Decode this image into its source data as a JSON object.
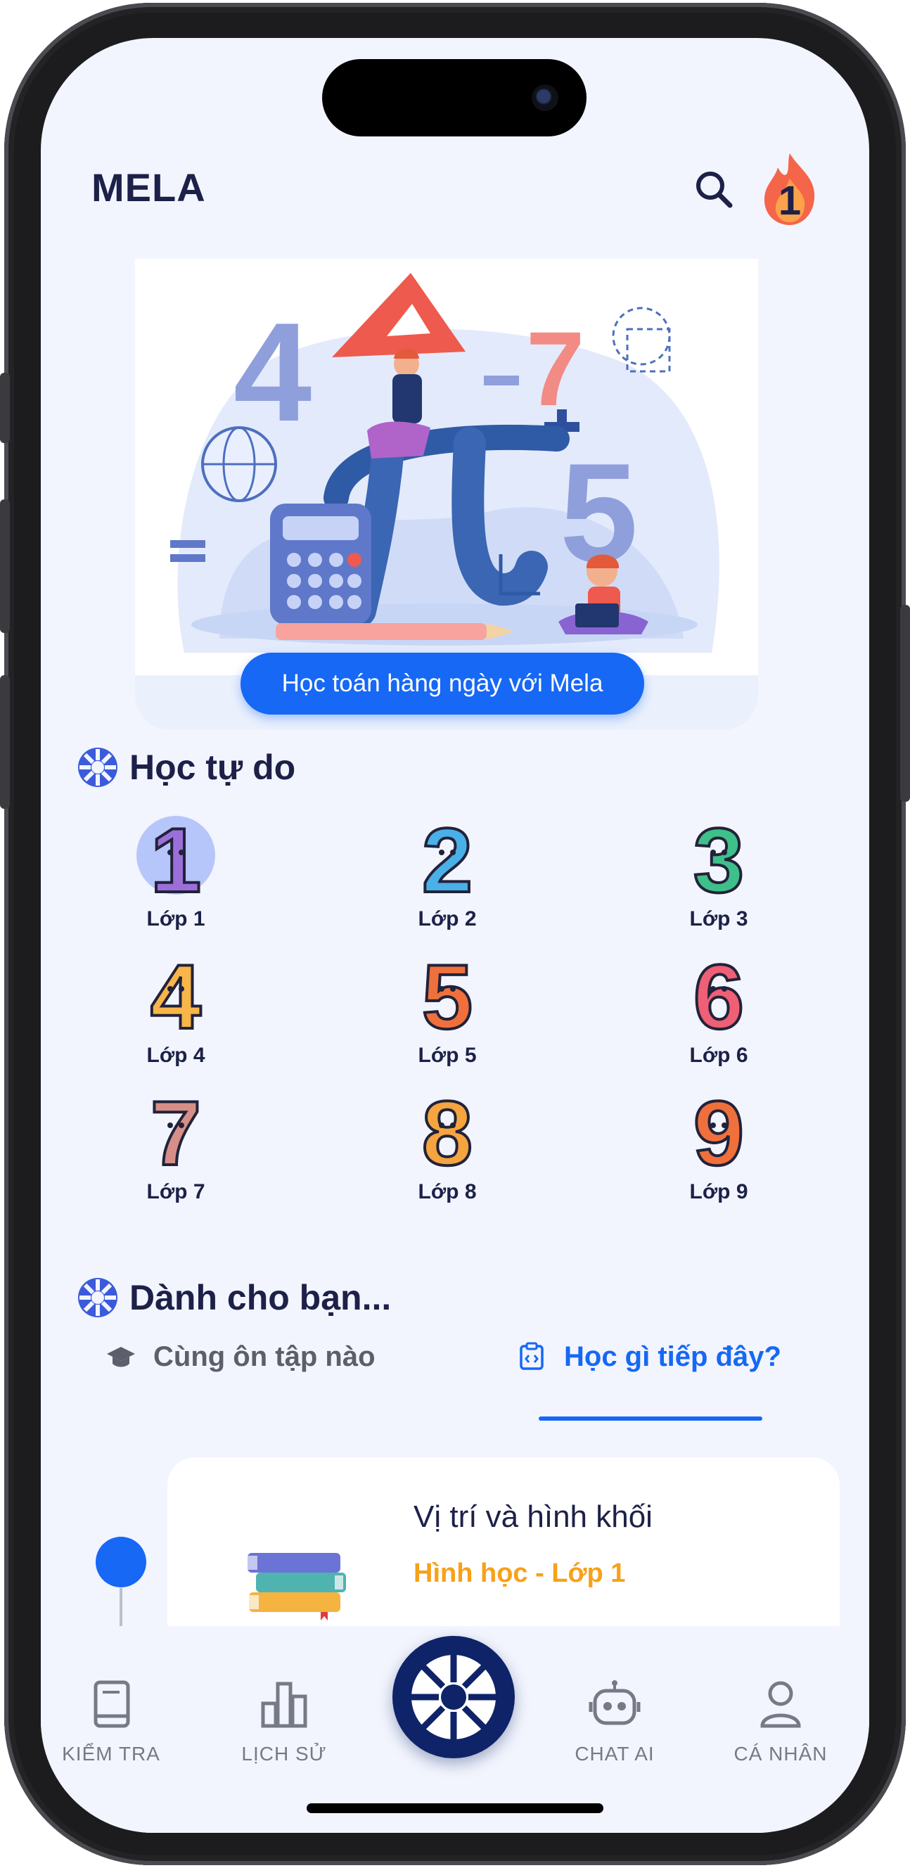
{
  "app": {
    "title": "MELA",
    "streak": "1"
  },
  "banner": {
    "cta": "Học toán hàng ngày với Mela"
  },
  "free_learning": {
    "title": "Học tự do",
    "grades": [
      {
        "label": "Lớp 1",
        "digit": "1",
        "color": "#9b6fd9"
      },
      {
        "label": "Lớp 2",
        "digit": "2",
        "color": "#4ab0e8"
      },
      {
        "label": "Lớp 3",
        "digit": "3",
        "color": "#3fbf8a"
      },
      {
        "label": "Lớp 4",
        "digit": "4",
        "color": "#f7b54a"
      },
      {
        "label": "Lớp 5",
        "digit": "5",
        "color": "#f0703c"
      },
      {
        "label": "Lớp 6",
        "digit": "6",
        "color": "#ef5f75"
      },
      {
        "label": "Lớp 7",
        "digit": "7",
        "color": "#d68f86"
      },
      {
        "label": "Lớp 8",
        "digit": "8",
        "color": "#f5a43f"
      },
      {
        "label": "Lớp 9",
        "digit": "9",
        "color": "#f0703c"
      }
    ]
  },
  "for_you": {
    "title": "Dành cho bạn...",
    "tabs": [
      {
        "label": "Cùng ôn tập nào",
        "active": false
      },
      {
        "label": "Học gì tiếp đây?",
        "active": true
      }
    ],
    "card": {
      "title": "Vị trí và hình khối",
      "subtitle": "Hình học - Lớp 1"
    }
  },
  "nav": [
    {
      "label": "KIỂM TRA",
      "icon": "book-icon"
    },
    {
      "label": "LỊCH SỬ",
      "icon": "bar-chart-icon"
    },
    {
      "label": "",
      "icon": "mela-wheel-icon"
    },
    {
      "label": "CHAT AI",
      "icon": "robot-icon"
    },
    {
      "label": "CÁ NHÂN",
      "icon": "user-icon"
    }
  ],
  "colors": {
    "accent": "#1668f5",
    "navy": "#1d2149",
    "orange": "#f7a11a"
  }
}
